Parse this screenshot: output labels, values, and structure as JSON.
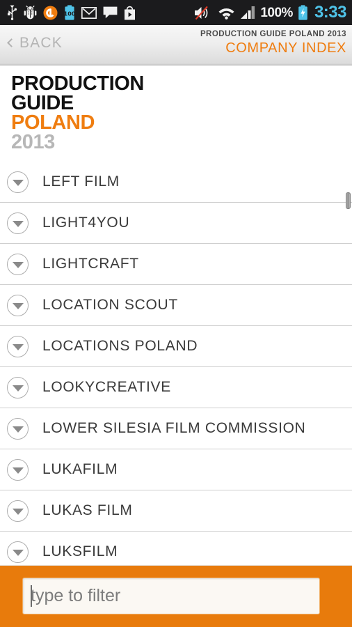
{
  "statusbar": {
    "left_icons": [
      {
        "name": "usb-icon",
        "label": "USB"
      },
      {
        "name": "android-debug-icon",
        "label": "ADB"
      },
      {
        "name": "orange-app-icon",
        "label": "App"
      },
      {
        "name": "battery-100-icon",
        "label": "100"
      },
      {
        "name": "gmail-icon",
        "label": "Gmail"
      },
      {
        "name": "messaging-icon",
        "label": "Messages"
      },
      {
        "name": "play-store-icon",
        "label": "Play Store"
      }
    ],
    "right_icons": [
      {
        "name": "speaker-mute-icon",
        "label": "Muted"
      },
      {
        "name": "wifi-icon",
        "label": "Wi-Fi"
      },
      {
        "name": "cellular-signal-icon",
        "label": "Signal"
      }
    ],
    "battery_percent": "100%",
    "battery_icon": "battery-charging-icon",
    "clock": "3:33",
    "clock_color": "#4fc3e8",
    "background": "#1b1b1d"
  },
  "header": {
    "back_label": "BACK",
    "back_icon": "chevron-left-icon",
    "superscript": "PRODUCTION GUIDE POLAND 2013",
    "title": "COMPANY INDEX",
    "title_color": "#ef7d10"
  },
  "logo": {
    "line1": "PRODUCTION",
    "line2": "GUIDE",
    "line3": "POLAND",
    "line4": "2013",
    "orange": "#ef7d10",
    "gray": "#b7b7b7"
  },
  "list": {
    "row_icon": "chevron-down-circle-icon",
    "items": [
      {
        "label": "LEFT FILM"
      },
      {
        "label": "LIGHT4YOU"
      },
      {
        "label": "LIGHTCRAFT"
      },
      {
        "label": "LOCATION SCOUT"
      },
      {
        "label": "LOCATIONS POLAND"
      },
      {
        "label": "LOOKYCREATIVE"
      },
      {
        "label": "LOWER SILESIA FILM COMMISSION"
      },
      {
        "label": "LUKAFILM"
      },
      {
        "label": "LUKAS FILM"
      },
      {
        "label": "LUKSFILM"
      }
    ]
  },
  "filter": {
    "placeholder": "type to filter",
    "value": "",
    "bar_color": "#e87b0c"
  }
}
